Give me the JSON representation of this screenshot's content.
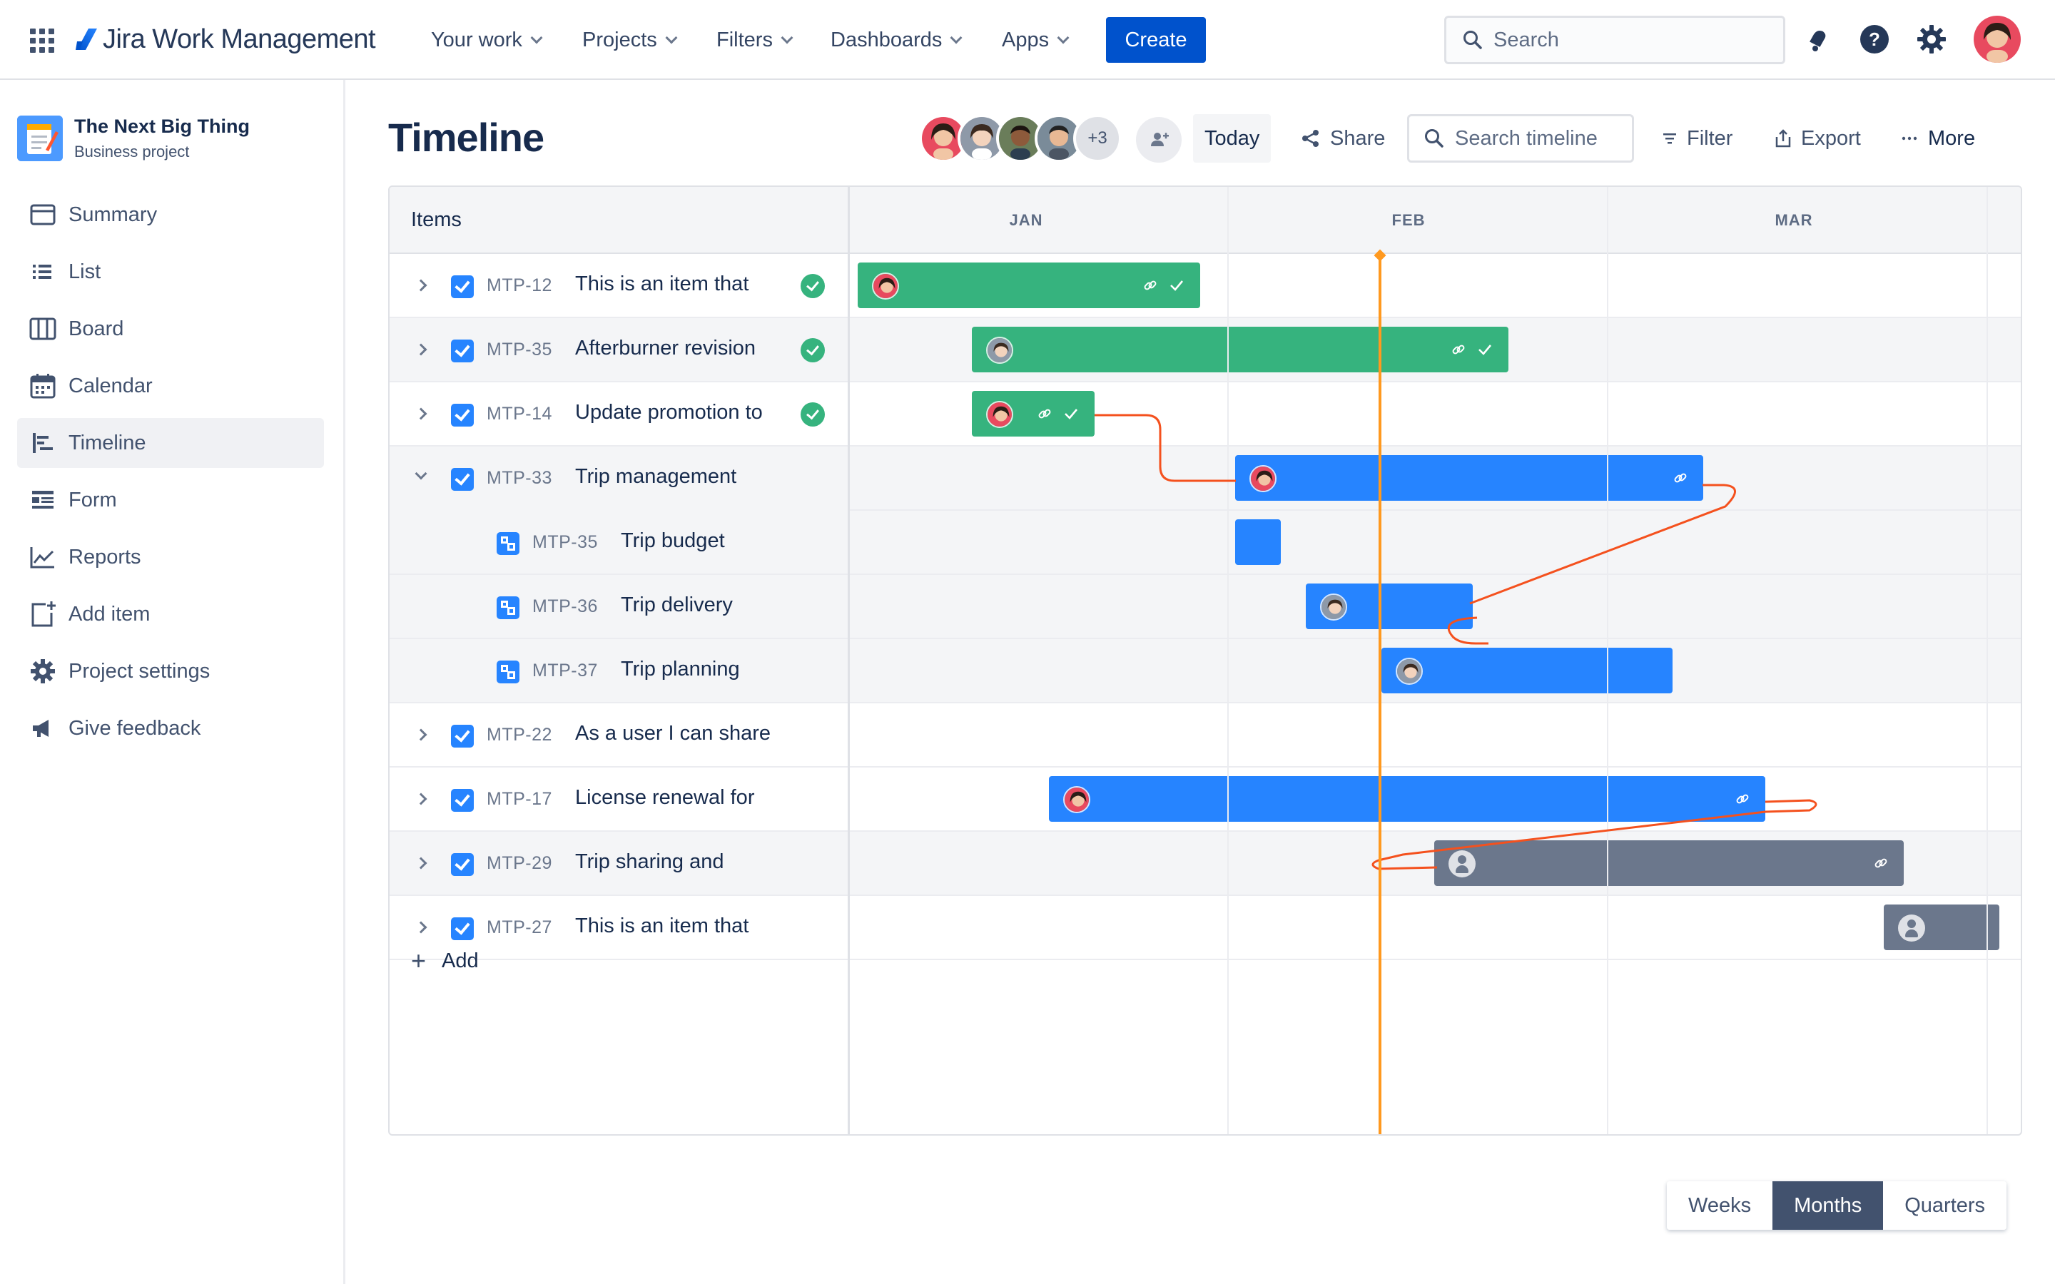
{
  "topnav": {
    "product": "Jira Work Management",
    "menus": [
      "Your work",
      "Projects",
      "Filters",
      "Dashboards",
      "Apps"
    ],
    "create_label": "Create",
    "search_placeholder": "Search"
  },
  "sidebar": {
    "project_name": "The Next Big Thing",
    "project_type": "Business project",
    "items": [
      {
        "label": "Summary",
        "icon": "summary-icon"
      },
      {
        "label": "List",
        "icon": "list-icon"
      },
      {
        "label": "Board",
        "icon": "board-icon"
      },
      {
        "label": "Calendar",
        "icon": "calendar-icon"
      },
      {
        "label": "Timeline",
        "icon": "timeline-icon",
        "active": true
      },
      {
        "label": "Form",
        "icon": "form-icon"
      },
      {
        "label": "Reports",
        "icon": "reports-icon"
      },
      {
        "label": "Add item",
        "icon": "add-item-icon"
      },
      {
        "label": "Project settings",
        "icon": "gear-icon"
      },
      {
        "label": "Give feedback",
        "icon": "megaphone-icon"
      }
    ]
  },
  "header": {
    "title": "Timeline",
    "more_people": "+3",
    "today_label": "Today",
    "share_label": "Share",
    "search_placeholder": "Search timeline",
    "filter_label": "Filter",
    "export_label": "Export",
    "more_label": "More"
  },
  "timeline": {
    "items_header": "Items",
    "months": [
      "JAN",
      "FEB",
      "MAR"
    ],
    "rows": [
      {
        "key": "MTP-12",
        "summary": "This is an item that",
        "done": true,
        "bar": "green"
      },
      {
        "key": "MTP-35",
        "summary": "Afterburner revision",
        "done": true,
        "bar": "green"
      },
      {
        "key": "MTP-14",
        "summary": "Update promotion to",
        "done": true,
        "bar": "green"
      },
      {
        "key": "MTP-33",
        "summary": "Trip management",
        "done": false,
        "bar": "blue",
        "expanded": true
      },
      {
        "key": "MTP-35",
        "summary": "Trip budget",
        "done": false,
        "bar": "blue",
        "child": true
      },
      {
        "key": "MTP-36",
        "summary": "Trip delivery",
        "done": false,
        "bar": "blue",
        "child": true
      },
      {
        "key": "MTP-37",
        "summary": "Trip planning",
        "done": false,
        "bar": "blue",
        "child": true
      },
      {
        "key": "MTP-22",
        "summary": "As a user I can share",
        "done": false,
        "bar": "none"
      },
      {
        "key": "MTP-17",
        "summary": "License renewal for",
        "done": false,
        "bar": "blue"
      },
      {
        "key": "MTP-29",
        "summary": "Trip sharing and",
        "done": false,
        "bar": "grey"
      },
      {
        "key": "MTP-27",
        "summary": "This is an item that",
        "done": false,
        "bar": "grey"
      }
    ],
    "add_label": "Add"
  },
  "zoom": {
    "options": [
      "Weeks",
      "Months",
      "Quarters"
    ],
    "selected": "Months"
  },
  "colors": {
    "primary": "#0052cc",
    "bar_green": "#36b37e",
    "bar_blue": "#2684ff",
    "bar_grey": "#6b778c",
    "today_line": "#ff991f",
    "dependency": "#f4511e"
  }
}
